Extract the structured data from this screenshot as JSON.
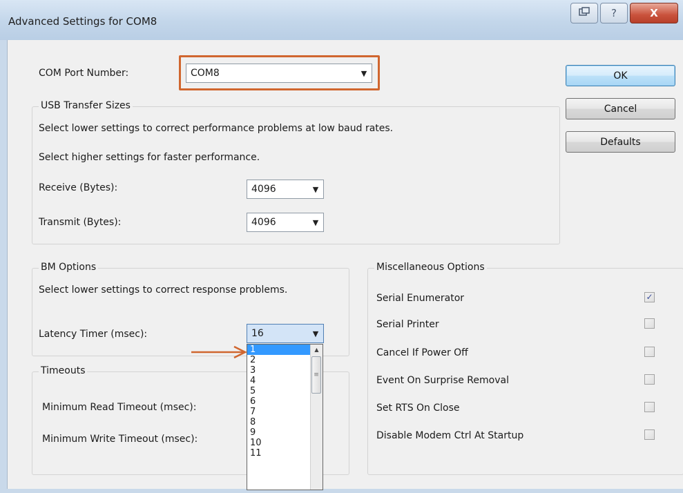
{
  "window": {
    "title": "Advanced Settings for COM8",
    "caption_buttons": [
      "restore-icon",
      "help-icon",
      "close-icon"
    ],
    "help_glyph": "?",
    "close_glyph": "X"
  },
  "com_port": {
    "label": "COM Port Number:",
    "value": "COM8"
  },
  "usb": {
    "title": "USB Transfer Sizes",
    "desc1": "Select lower settings to correct performance problems at low baud rates.",
    "desc2": "Select higher settings for faster performance.",
    "receive_label": "Receive (Bytes):",
    "receive_value": "4096",
    "transmit_label": "Transmit (Bytes):",
    "transmit_value": "4096"
  },
  "bm": {
    "title": "BM Options",
    "desc": "Select lower settings to correct response problems.",
    "latency_label": "Latency Timer (msec):",
    "latency_value": "16"
  },
  "timeouts": {
    "title": "Timeouts",
    "read_label": "Minimum Read Timeout (msec):",
    "write_label": "Minimum Write Timeout (msec):"
  },
  "latency_dropdown": {
    "options": [
      "1",
      "2",
      "3",
      "4",
      "5",
      "6",
      "7",
      "8",
      "9",
      "10",
      "11"
    ],
    "selected": "1"
  },
  "misc": {
    "title": "Miscellaneous Options",
    "items": [
      {
        "label": "Serial Enumerator",
        "checked": true
      },
      {
        "label": "Serial Printer",
        "checked": false
      },
      {
        "label": "Cancel If Power Off",
        "checked": false
      },
      {
        "label": "Event On Surprise Removal",
        "checked": false
      },
      {
        "label": "Set RTS On Close",
        "checked": false
      },
      {
        "label": "Disable Modem Ctrl At Startup",
        "checked": false
      }
    ]
  },
  "buttons": {
    "ok": "OK",
    "cancel": "Cancel",
    "defaults": "Defaults"
  },
  "colors": {
    "annotation": "#d0662f",
    "selection": "#3399ff",
    "default_button": "#3c7fb1"
  }
}
